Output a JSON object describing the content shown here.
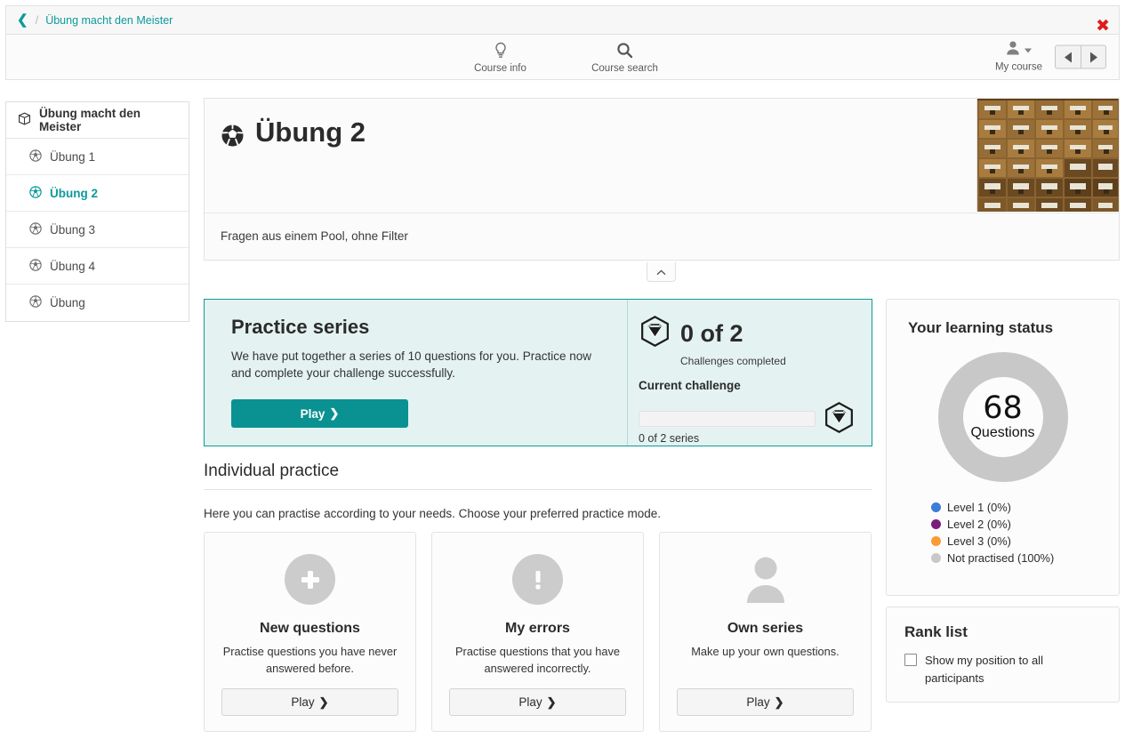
{
  "breadcrumb": {
    "back_icon": "chevron-left-icon",
    "separator": "/",
    "link": "Übung macht den Meister",
    "close_label": "✖",
    "accent_color": "#0d9a9a"
  },
  "nav": {
    "items": [
      {
        "label": "Course info",
        "icon": "lightbulb-icon"
      },
      {
        "label": "Course search",
        "icon": "search-icon"
      }
    ],
    "user": {
      "label": "My course",
      "icon": "user-icon"
    },
    "prev_label": "◀",
    "next_label": "▶"
  },
  "sidebar": {
    "header": {
      "label": "Übung macht den Meister",
      "icon": "cube-icon"
    },
    "items": [
      {
        "label": "Übung 1",
        "icon": "football-icon",
        "active": false
      },
      {
        "label": "Übung 2",
        "icon": "football-icon",
        "active": true
      },
      {
        "label": "Übung 3",
        "icon": "football-icon",
        "active": false
      },
      {
        "label": "Übung 4",
        "icon": "football-icon",
        "active": false
      },
      {
        "label": "Übung",
        "icon": "football-icon",
        "active": false
      }
    ]
  },
  "course": {
    "title": "Übung 2",
    "title_icon": "football-icon",
    "description": "Fragen aus einem Pool, ohne Filter",
    "hero_image_alt": "library card catalog drawers"
  },
  "collapse": {
    "icon": "chevron-up-icon"
  },
  "practice_series": {
    "title": "Practice series",
    "text": "We have put together a series of 10 questions for you. Practice now and complete your challenge successfully.",
    "play_label": "Play",
    "play_chevron": "❯",
    "challenge_count": "0 of 2",
    "challenge_caption": "Challenges completed",
    "current_challenge_label": "Current challenge",
    "progress_percent": 0,
    "progress_label": "0 of 2 series",
    "gem_icon": "gem-hexagon-icon",
    "accent_color": "#0a9191",
    "panel_bg": "#e4f3f1"
  },
  "individual_practice": {
    "heading": "Individual practice",
    "subtext": "Here you can practise according to your needs. Choose your preferred practice mode.",
    "cards": [
      {
        "title": "New questions",
        "description": "Practise questions you have never answered before.",
        "icon": "plus-circle-icon",
        "play_label": "Play"
      },
      {
        "title": "My errors",
        "description": "Practise questions that you have answered incorrectly.",
        "icon": "exclamation-circle-icon",
        "play_label": "Play"
      },
      {
        "title": "Own series",
        "description": "Make up your own questions.",
        "icon": "user-circle-icon",
        "play_label": "Play"
      }
    ]
  },
  "learning_status": {
    "title": "Your learning status",
    "total": "68",
    "total_label": "Questions",
    "legend": [
      {
        "label": "Level 1 (0%)",
        "color": "#3b7dd8",
        "value": 0
      },
      {
        "label": "Level 2 (0%)",
        "color": "#7b1d7b",
        "value": 0
      },
      {
        "label": "Level 3 (0%)",
        "color": "#fa9b34",
        "value": 0
      },
      {
        "label": "Not practised (100%)",
        "color": "#c8c8c8",
        "value": 100
      }
    ]
  },
  "rank_list": {
    "title": "Rank list",
    "checkbox_label": "Show my position to all participants",
    "checked": false
  },
  "chart_data": {
    "type": "pie",
    "title": "Your learning status",
    "categories": [
      "Level 1",
      "Level 2",
      "Level 3",
      "Not practised"
    ],
    "values": [
      0,
      0,
      0,
      100
    ],
    "colors": [
      "#3b7dd8",
      "#7b1d7b",
      "#fa9b34",
      "#c8c8c8"
    ],
    "center_value": 68,
    "center_label": "Questions",
    "legend_position": "bottom",
    "donut": true
  }
}
